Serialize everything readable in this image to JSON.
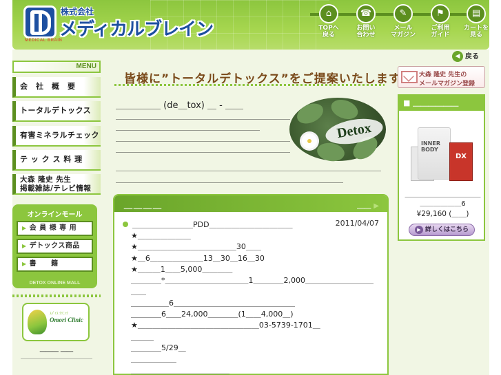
{
  "header": {
    "logo_small": "株式会社",
    "logo_big": "メディカルブレイン",
    "logo_sub": "MEDICAL BRAIN",
    "nav": [
      {
        "icon": "home-icon",
        "glyph": "⌂",
        "label": "TOPへ\n戻る"
      },
      {
        "icon": "phone-icon",
        "glyph": "☎",
        "label": "お問い\n合わせ"
      },
      {
        "icon": "pen-icon",
        "glyph": "✎",
        "label": "メール\nマガジン"
      },
      {
        "icon": "flag-icon",
        "glyph": "⚑",
        "label": "ご利用\nガイド"
      },
      {
        "icon": "cart-icon",
        "glyph": "▤",
        "label": "カートを\n見る"
      }
    ],
    "back_label": "戻る"
  },
  "sidebar": {
    "menu_label": "MENU",
    "items": [
      {
        "label": "会　社　概　要"
      },
      {
        "label": "トータルデトックス"
      },
      {
        "label": "有害ミネラルチェック"
      },
      {
        "label": "テ ッ ク ス 料 理"
      },
      {
        "label_line1": "大森 隆史 先生",
        "label_line2": "掲載雑誌/テレビ情報"
      }
    ],
    "mall": {
      "title": "オンラインモール",
      "buttons": [
        "会 員 様 専 用",
        "デトックス商品",
        "書　　籍"
      ],
      "footer": "DETOX ONLINE MALL"
    },
    "clinic": {
      "logo_sub": "ｽﾊﾟｲｽ ｸﾘﾆｯｸ",
      "logo_name": "Omori Clinic",
      "caption1": "＿＿＿ ＿＿",
      "caption2": "＿＿＿＿＿＿＿＿＿＿＿＿＿"
    }
  },
  "main": {
    "banner_title": "皆様に”トータルデトックス”をご提案いたします",
    "intro_head": "＿＿＿＿＿ (de＿tox) ＿ - ＿＿",
    "intro_p1": "＿＿＿＿＿＿＿＿＿＿＿＿＿＿＿＿＿＿＿＿＿＿＿＿＿＿＿＿＿＿＿＿＿＿＿＿＿＿＿＿＿＿",
    "intro_p2": "＿＿＿＿＿＿＿＿＿＿＿＿＿＿＿＿＿＿＿＿＿＿＿＿＿＿＿＿＿＿＿＿＿＿＿＿＿＿＿＿＿＿＿＿＿＿",
    "intro_wide": "＿＿＿＿＿＿＿＿＿＿＿＿＿＿＿＿＿＿＿＿＿＿＿＿＿＿＿＿＿＿＿＿＿＿＿＿＿＿＿＿＿＿＿＿＿＿＿＿＿＿＿＿＿＿＿＿＿＿＿＿＿＿＿＿＿",
    "detox_word": "Detox",
    "news": {
      "title": "＿＿＿＿",
      "more_label": "＿＿",
      "item_title": "＿＿＿＿＿＿＿＿PDD＿＿＿＿＿＿＿＿＿＿＿",
      "date": "2011/04/07",
      "body_lines": [
        "★＿＿＿＿＿＿＿",
        "★＿＿＿＿＿＿＿＿＿＿＿＿＿30＿＿",
        "★＿6＿＿＿＿＿＿＿13＿30＿16＿30",
        "★＿＿＿1＿＿5,000＿＿＿＿",
        "＿＿＿＿*＿＿＿＿＿＿＿＿＿＿＿1＿＿＿＿2,000＿＿＿＿＿＿＿＿＿＿＿",
        "＿＿＿＿＿6＿＿＿＿＿＿＿＿＿＿＿＿＿＿＿＿",
        "＿＿＿＿6＿＿24,000＿＿＿＿(1＿＿4,000＿)",
        "★＿＿＿＿＿＿＿＿＿＿＿＿＿＿＿＿03-5739-1701＿",
        "＿＿＿",
        "＿＿＿＿5/29＿",
        "＿＿＿＿＿＿",
        "＿＿＿＿＿＿＿＿＿＿＿＿＿",
        "＿＿＿＿＿＿＿＿＿＿＿＿＿＿"
      ]
    }
  },
  "right": {
    "mag_line1": "大森 隆史 先生の",
    "mag_line2": "メールマガジン登録",
    "product_head": "■ ＿＿＿＿＿＿",
    "product_tub_label": "INNER BODY",
    "product_box_label": "DX",
    "product_name": "＿＿＿＿＿＿＿＿＿＿＿＿＿＿＿＿＿6",
    "product_price": "¥29,160 (＿＿)",
    "detail_button": "詳しくはこちら"
  }
}
